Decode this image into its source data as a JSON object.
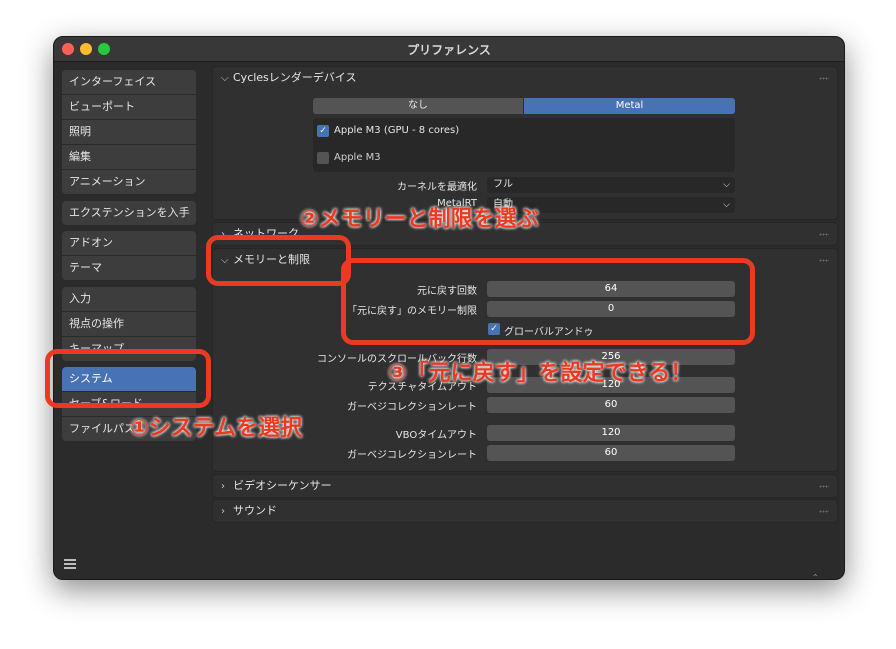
{
  "window": {
    "title": "プリファレンス"
  },
  "sidebar": {
    "groups": [
      [
        "インターフェイス",
        "ビューポート",
        "照明",
        "編集",
        "アニメーション"
      ],
      [
        "エクステンションを入手"
      ],
      [
        "アドオン",
        "テーマ"
      ],
      [
        "入力",
        "視点の操作",
        "キーマップ"
      ],
      [
        "システム",
        "セーブ&ロード",
        "ファイルパス"
      ]
    ],
    "active": "システム"
  },
  "panels": {
    "cycles": {
      "title": "Cyclesレンダーデバイス",
      "tabs": [
        "なし",
        "Metal"
      ],
      "active_tab": "Metal",
      "devices": [
        {
          "label": "Apple M3 (GPU - 8 cores)",
          "checked": true
        },
        {
          "label": "Apple M3",
          "checked": false
        }
      ],
      "kernel_label": "カーネルを最適化",
      "kernel_value": "フル",
      "metalrt_label": "MetalRT",
      "metalrt_value": "自動"
    },
    "network": {
      "title": "ネットワーク"
    },
    "memory": {
      "title": "メモリーと制限",
      "undo_steps_label": "元に戻す回数",
      "undo_steps_value": "64",
      "undo_memory_label": "「元に戻す」のメモリー制限",
      "undo_memory_value": "0",
      "global_undo_label": "グローバルアンドゥ",
      "global_undo_checked": true,
      "scrollback_label": "コンソールのスクロールバック行数",
      "scrollback_value": "256",
      "texture_timeout_label": "テクスチャタイムアウト",
      "texture_timeout_value": "120",
      "texture_gc_label": "ガーベジコレクションレート",
      "texture_gc_value": "60",
      "vbo_timeout_label": "VBOタイムアウト",
      "vbo_timeout_value": "120",
      "vbo_gc_label": "ガーベジコレクションレート",
      "vbo_gc_value": "60"
    },
    "video": {
      "title": "ビデオシーケンサー"
    },
    "sound": {
      "title": "サウンド"
    }
  },
  "annotations": {
    "step1": "①システムを選択",
    "step2": "②メモリーと制限を選ぶ",
    "step3": "③「元に戻す」を設定できる！",
    "color": "#ea3a22"
  },
  "colors": {
    "accent": "#4772b3",
    "panel": "#303030",
    "background": "#2b2b2b"
  }
}
